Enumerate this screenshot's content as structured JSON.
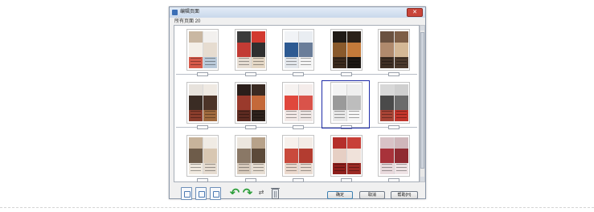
{
  "dialog": {
    "title": "编辑页面",
    "close_label": "✕",
    "page_count_label": "所有页面 20"
  },
  "thumbnails": [
    {
      "page": 1,
      "row": 0,
      "col": 0,
      "num": "",
      "selected": false,
      "left": [
        "#c9b7a2",
        "#f4efe8",
        "#d65a4a"
      ],
      "right": [
        "#f2f0ee",
        "#e6dcd0",
        "#b9c9d9"
      ]
    },
    {
      "page": 2,
      "row": 0,
      "col": 1,
      "num": "",
      "selected": false,
      "left": [
        "#3b3b3b",
        "#c23b34",
        "#e7ded4"
      ],
      "right": [
        "#d2392f",
        "#2f2f2f",
        "#e4d7c5"
      ]
    },
    {
      "page": 3,
      "row": 0,
      "col": 2,
      "num": "",
      "selected": false,
      "left": [
        "#f1f3f6",
        "#2d5a92",
        "#e3e7ec"
      ],
      "right": [
        "#e9edf2",
        "#6a7d99",
        "#f4f4f4"
      ]
    },
    {
      "page": 4,
      "row": 0,
      "col": 3,
      "num": "",
      "selected": false,
      "left": [
        "#1f1a16",
        "#8a5a2c",
        "#3b2a1d"
      ],
      "right": [
        "#2a2018",
        "#c47a3a",
        "#1c1713"
      ]
    },
    {
      "page": 5,
      "row": 0,
      "col": 4,
      "num": "",
      "selected": false,
      "left": [
        "#6a5140",
        "#b08a6d",
        "#3e2f24"
      ],
      "right": [
        "#7d5e47",
        "#d4b896",
        "#4a392c"
      ]
    },
    {
      "page": 6,
      "row": 1,
      "col": 0,
      "num": "",
      "selected": false,
      "left": [
        "#e7e2dc",
        "#3a2c24",
        "#8a3d2c"
      ],
      "right": [
        "#efe9e2",
        "#4c3428",
        "#a06a3e"
      ]
    },
    {
      "page": 7,
      "row": 1,
      "col": 1,
      "num": "",
      "selected": false,
      "left": [
        "#2a1e1a",
        "#9a3a2c",
        "#5c2a20"
      ],
      "right": [
        "#3a2a22",
        "#c4693a",
        "#2e221c"
      ]
    },
    {
      "page": 8,
      "row": 1,
      "col": 2,
      "num": "",
      "selected": false,
      "left": [
        "#f6f2f0",
        "#e0473c",
        "#f2e8e6"
      ],
      "right": [
        "#f4ecea",
        "#d9534a",
        "#eee6e4"
      ]
    },
    {
      "page": 9,
      "row": 1,
      "col": 3,
      "num": "",
      "selected": true,
      "left": [
        "#f4f4f4",
        "#9a9a9a",
        "#e8e8e8"
      ],
      "right": [
        "#efefef",
        "#bdbdbd",
        "#f6f6f6"
      ]
    },
    {
      "page": 10,
      "row": 1,
      "col": 4,
      "num": "",
      "selected": false,
      "left": [
        "#d8d8d8",
        "#4a4a4a",
        "#a84436"
      ],
      "right": [
        "#cfcfcf",
        "#6b6b6b",
        "#c2352c"
      ]
    },
    {
      "page": 11,
      "row": 2,
      "col": 0,
      "num": "",
      "selected": false,
      "left": [
        "#c7b39b",
        "#6e5c4a",
        "#efe8de"
      ],
      "right": [
        "#f0ebe4",
        "#d8c7b2",
        "#e5dbcf"
      ]
    },
    {
      "page": 12,
      "row": 2,
      "col": 1,
      "num": "",
      "selected": false,
      "left": [
        "#ece6de",
        "#8a7866",
        "#d8cbbd"
      ],
      "right": [
        "#b7a28a",
        "#5c4a3a",
        "#e6ddd2"
      ]
    },
    {
      "page": 13,
      "row": 2,
      "col": 2,
      "num": "",
      "selected": false,
      "left": [
        "#f7f1ec",
        "#c94a3c",
        "#ead8cc"
      ],
      "right": [
        "#f3ece6",
        "#b33c30",
        "#e9dcd2"
      ]
    },
    {
      "page": 14,
      "row": 2,
      "col": 3,
      "num": "",
      "selected": false,
      "left": [
        "#b52e2a",
        "#e6cfc4",
        "#8e1f1c"
      ],
      "right": [
        "#c84038",
        "#f0e2da",
        "#9c2a24"
      ]
    },
    {
      "page": 15,
      "row": 2,
      "col": 4,
      "num": "",
      "selected": false,
      "left": [
        "#d8c2c6",
        "#a8323a",
        "#e9dadd"
      ],
      "right": [
        "#cfb6ba",
        "#8f2a31",
        "#efe3e5"
      ]
    }
  ],
  "toolbar": {
    "icons": [
      "page-insert-icon",
      "page-copy-icon",
      "page-replace-icon",
      "rotate-left-icon",
      "rotate-right-icon",
      "move-arrows-icon",
      "trash-icon"
    ]
  },
  "buttons": {
    "ok_label": "确定",
    "cancel_label": "取消",
    "help_label": "帮助(H)"
  },
  "colors": {
    "selection": "#1e2ba8",
    "rotate_green": "#2c9e3a"
  }
}
